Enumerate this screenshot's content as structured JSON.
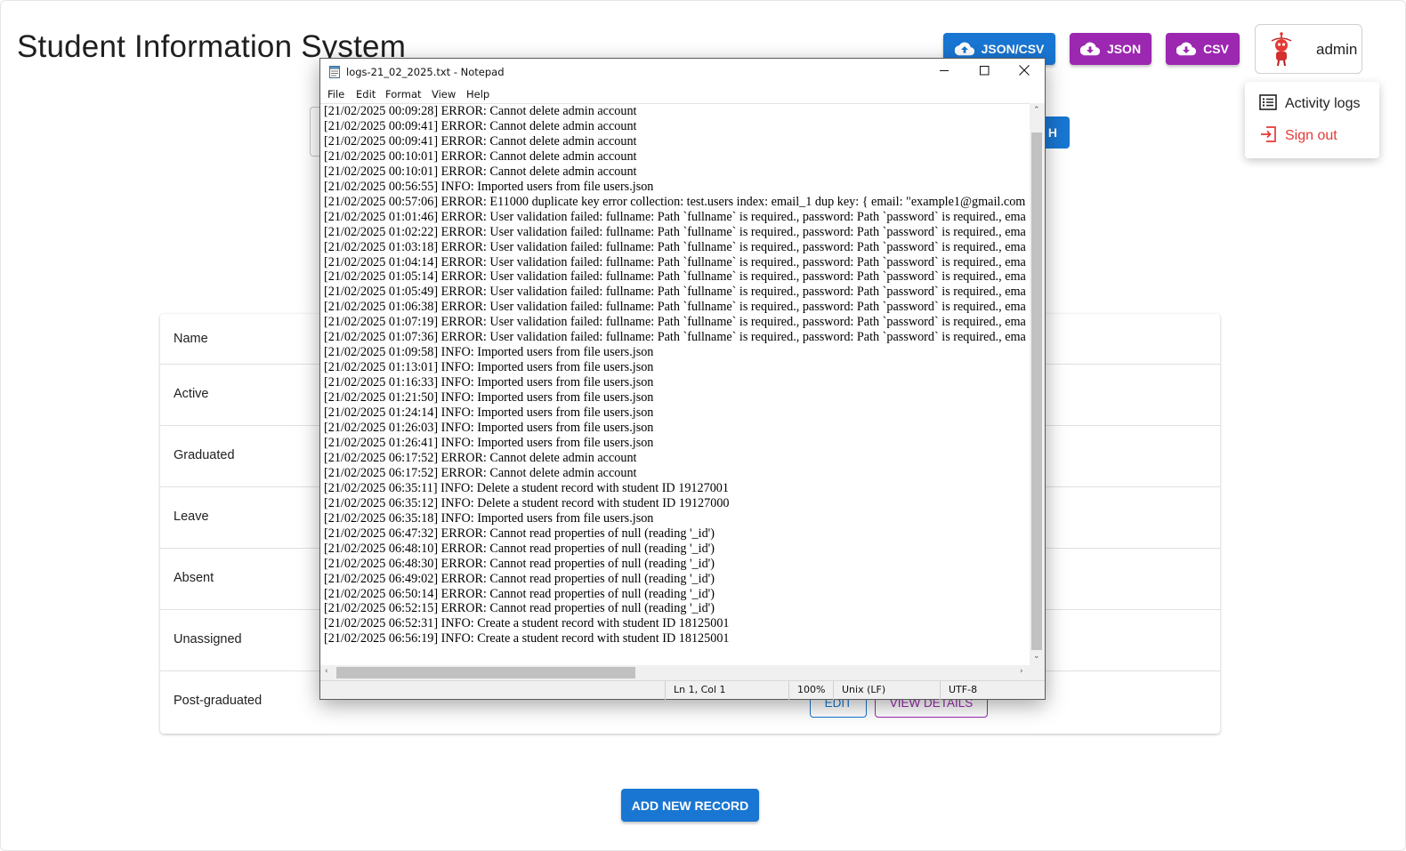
{
  "app": {
    "title": "Student Information System"
  },
  "header": {
    "buttons": [
      {
        "label": "JSON/CSV",
        "icon": "cloud-upload-icon",
        "color": "#1976d2"
      },
      {
        "label": "JSON",
        "icon": "cloud-download-icon",
        "color": "#9c27b0"
      },
      {
        "label": "CSV",
        "icon": "cloud-download-icon",
        "color": "#9c27b0"
      }
    ],
    "user": {
      "name": "admin",
      "avatar_icon": "robot-avatar-icon"
    }
  },
  "user_menu": {
    "items": [
      {
        "label": "Activity logs",
        "icon": "list-icon"
      },
      {
        "label": "Sign out",
        "icon": "sign-out-icon",
        "color": "#e53935"
      }
    ]
  },
  "search": {
    "button_label": "H"
  },
  "status_table": {
    "rows": [
      {
        "label": "Name"
      },
      {
        "label": "Active"
      },
      {
        "label": "Graduated"
      },
      {
        "label": "Leave"
      },
      {
        "label": "Absent"
      },
      {
        "label": "Unassigned"
      },
      {
        "label": "Post-graduated"
      }
    ],
    "row_actions": {
      "edit": "EDIT",
      "view": "VIEW DETAILS"
    }
  },
  "add_button": {
    "label": "ADD NEW RECORD"
  },
  "notepad": {
    "title": "logs-21_02_2025.txt - Notepad",
    "menu": [
      "File",
      "Edit",
      "Format",
      "View",
      "Help"
    ],
    "lines": [
      "[21/02/2025 00:09:28] ERROR: Cannot delete admin account",
      "[21/02/2025 00:09:41] ERROR: Cannot delete admin account",
      "[21/02/2025 00:09:41] ERROR: Cannot delete admin account",
      "[21/02/2025 00:10:01] ERROR: Cannot delete admin account",
      "[21/02/2025 00:10:01] ERROR: Cannot delete admin account",
      "[21/02/2025 00:56:55] INFO: Imported users from file users.json",
      "[21/02/2025 00:57:06] ERROR: E11000 duplicate key error collection: test.users index: email_1 dup key: { email: \"example1@gmail.com",
      "[21/02/2025 01:01:46] ERROR: User validation failed: fullname: Path `fullname` is required., password: Path `password` is required., ema",
      "[21/02/2025 01:02:22] ERROR: User validation failed: fullname: Path `fullname` is required., password: Path `password` is required., ema",
      "[21/02/2025 01:03:18] ERROR: User validation failed: fullname: Path `fullname` is required., password: Path `password` is required., ema",
      "[21/02/2025 01:04:14] ERROR: User validation failed: fullname: Path `fullname` is required., password: Path `password` is required., ema",
      "[21/02/2025 01:05:14] ERROR: User validation failed: fullname: Path `fullname` is required., password: Path `password` is required., ema",
      "[21/02/2025 01:05:49] ERROR: User validation failed: fullname: Path `fullname` is required., password: Path `password` is required., ema",
      "[21/02/2025 01:06:38] ERROR: User validation failed: fullname: Path `fullname` is required., password: Path `password` is required., ema",
      "[21/02/2025 01:07:19] ERROR: User validation failed: fullname: Path `fullname` is required., password: Path `password` is required., ema",
      "[21/02/2025 01:07:36] ERROR: User validation failed: fullname: Path `fullname` is required., password: Path `password` is required., ema",
      "[21/02/2025 01:09:58] INFO: Imported users from file users.json",
      "[21/02/2025 01:13:01] INFO: Imported users from file users.json",
      "[21/02/2025 01:16:33] INFO: Imported users from file users.json",
      "[21/02/2025 01:21:50] INFO: Imported users from file users.json",
      "[21/02/2025 01:24:14] INFO: Imported users from file users.json",
      "[21/02/2025 01:26:03] INFO: Imported users from file users.json",
      "[21/02/2025 01:26:41] INFO: Imported users from file users.json",
      "[21/02/2025 06:17:52] ERROR: Cannot delete admin account",
      "[21/02/2025 06:17:52] ERROR: Cannot delete admin account",
      "[21/02/2025 06:35:11] INFO: Delete a student record with student ID 19127001",
      "[21/02/2025 06:35:12] INFO: Delete a student record with student ID 19127000",
      "[21/02/2025 06:35:18] INFO: Imported users from file users.json",
      "[21/02/2025 06:47:32] ERROR: Cannot read properties of null (reading '_id')",
      "[21/02/2025 06:48:10] ERROR: Cannot read properties of null (reading '_id')",
      "[21/02/2025 06:48:30] ERROR: Cannot read properties of null (reading '_id')",
      "[21/02/2025 06:49:02] ERROR: Cannot read properties of null (reading '_id')",
      "[21/02/2025 06:50:14] ERROR: Cannot read properties of null (reading '_id')",
      "[21/02/2025 06:52:15] ERROR: Cannot read properties of null (reading '_id')",
      "[21/02/2025 06:52:31] INFO: Create a student record with student ID 18125001",
      "[21/02/2025 06:56:19] INFO: Create a student record with student ID 18125001"
    ],
    "status": {
      "position": "Ln 1, Col 1",
      "zoom": "100%",
      "line_ending": "Unix (LF)",
      "encoding": "UTF-8"
    }
  }
}
